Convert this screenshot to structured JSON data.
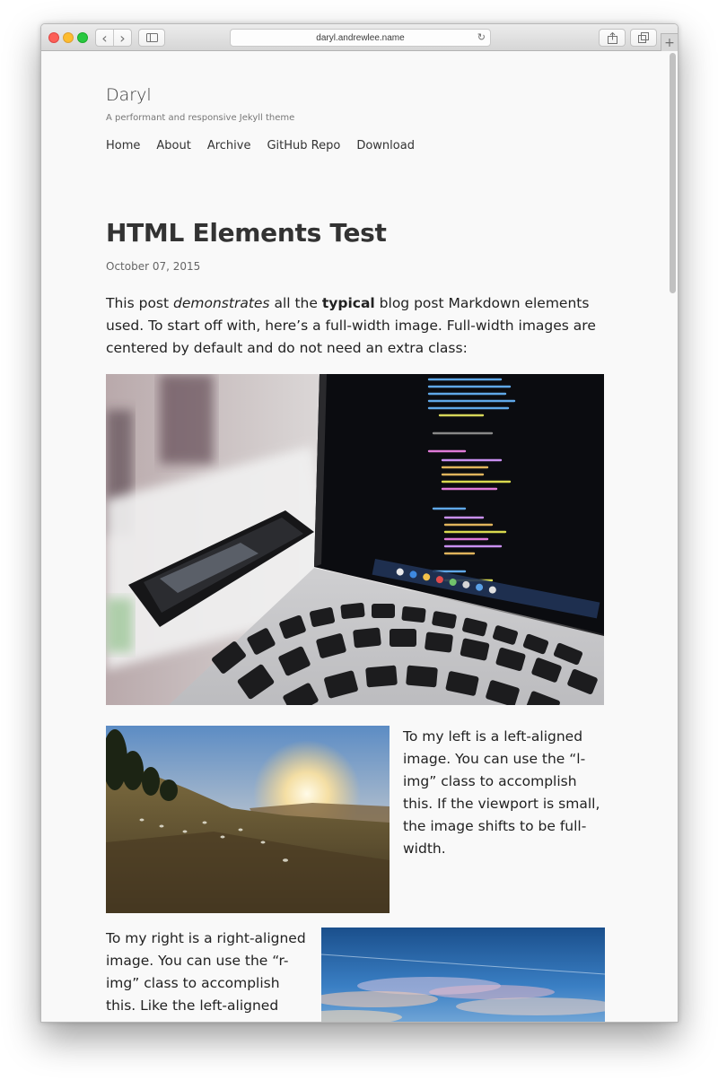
{
  "browser": {
    "url": "daryl.andrewlee.name",
    "back_icon": "‹",
    "forward_icon": "›",
    "reload_icon": "↻",
    "new_tab_icon": "+"
  },
  "site": {
    "title": "Daryl",
    "description": "A performant and responsive Jekyll theme",
    "nav": [
      "Home",
      "About",
      "Archive",
      "GitHub Repo",
      "Download"
    ]
  },
  "post": {
    "title": "HTML Elements Test",
    "date": "October 07, 2015",
    "intro_prefix": "This post ",
    "intro_em": "demonstrates",
    "intro_mid": " all the ",
    "intro_strong": "typical",
    "intro_suffix": " blog post Markdown elements used. To start off with, here’s a full-width image. Full-width images are centered by default and do not need an extra class:",
    "left_text": "To my left is a left-aligned image. You can use the “l-img” class to accomplish this. If the viewport is small, the image shifts to be full-width.",
    "right_text": "To my right is a right-aligned image. You can use the “r-img” class to accomplish this. Like the left-aligned image, if the"
  },
  "colors": {
    "accent_close": "#fc5f57",
    "accent_min": "#fdbc2e",
    "accent_max": "#28c840"
  }
}
